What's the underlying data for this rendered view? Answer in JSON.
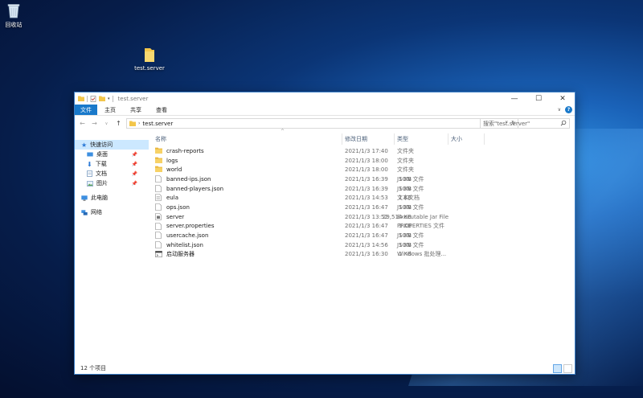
{
  "desktop": {
    "recycle_bin_label": "回收站",
    "folder_label": "test.server"
  },
  "window": {
    "title": "test.server",
    "controls": {
      "minimize": "—",
      "maximize": "☐",
      "close": "✕"
    },
    "ribbon_tabs": {
      "file": "文件",
      "home": "主页",
      "share": "共享",
      "view": "查看"
    },
    "address": {
      "path": "test.server"
    },
    "search": {
      "placeholder": "搜索\"test.server\""
    },
    "navpane": {
      "quick_access": "快速访问",
      "desktop": "桌面",
      "downloads": "下载",
      "documents": "文档",
      "pictures": "图片",
      "this_pc": "此电脑",
      "network": "网络"
    },
    "columns": {
      "name": "名称",
      "date": "修改日期",
      "type": "类型",
      "size": "大小"
    },
    "files": [
      {
        "name": "crash-reports",
        "date": "2021/1/3 17:40",
        "type": "文件夹",
        "size": "",
        "icon": "folder-icon"
      },
      {
        "name": "logs",
        "date": "2021/1/3 18:00",
        "type": "文件夹",
        "size": "",
        "icon": "folder-icon"
      },
      {
        "name": "world",
        "date": "2021/1/3 18:00",
        "type": "文件夹",
        "size": "",
        "icon": "folder-icon"
      },
      {
        "name": "banned-ips.json",
        "date": "2021/1/3 16:39",
        "type": "JSON 文件",
        "size": "1 KB",
        "icon": "file-icon"
      },
      {
        "name": "banned-players.json",
        "date": "2021/1/3 16:39",
        "type": "JSON 文件",
        "size": "1 KB",
        "icon": "file-icon"
      },
      {
        "name": "eula",
        "date": "2021/1/3 14:53",
        "type": "文本文档",
        "size": "1 KB",
        "icon": "text-file-icon"
      },
      {
        "name": "ops.json",
        "date": "2021/1/3 16:47",
        "type": "JSON 文件",
        "size": "1 KB",
        "icon": "file-icon"
      },
      {
        "name": "server",
        "date": "2021/1/3 13:52",
        "type": "Executable Jar File",
        "size": "29,514 KB",
        "icon": "jar-file-icon"
      },
      {
        "name": "server.properties",
        "date": "2021/1/3 16:47",
        "type": "PROPERTIES 文件",
        "size": "1 KB",
        "icon": "file-icon"
      },
      {
        "name": "usercache.json",
        "date": "2021/1/3 16:47",
        "type": "JSON 文件",
        "size": "1 KB",
        "icon": "file-icon"
      },
      {
        "name": "whitelist.json",
        "date": "2021/1/3 14:56",
        "type": "JSON 文件",
        "size": "1 KB",
        "icon": "file-icon"
      },
      {
        "name": "启动服务器",
        "date": "2021/1/3 16:30",
        "type": "Windows 批处理...",
        "size": "1 KB",
        "icon": "batch-file-icon"
      }
    ],
    "status": {
      "item_count": "12 个项目"
    }
  },
  "colors": {
    "accent": "#1979ca",
    "folder": "#f3c64a",
    "selection": "#cce8ff"
  }
}
